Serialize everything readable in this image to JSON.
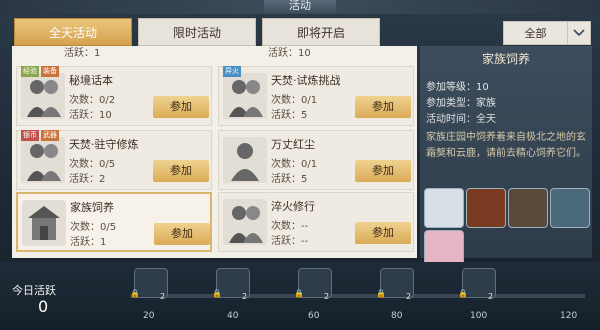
{
  "header": {
    "title": "活动"
  },
  "tabs": [
    {
      "label": "全天活动",
      "active": true
    },
    {
      "label": "限时活动",
      "active": false
    },
    {
      "label": "即将开启",
      "active": false
    }
  ],
  "filter": {
    "value": "全部"
  },
  "top_partial": {
    "left": "活跃：1",
    "right": "活跃：10"
  },
  "activities": [
    {
      "name": "秘境话本",
      "count": "次数：0/2",
      "active": "活跃：10",
      "button": "参加",
      "tags": [
        "经验",
        "装备"
      ]
    },
    {
      "name": "天焚·试炼挑战",
      "count": "次数：0/1",
      "active": "活跃：5",
      "button": "参加",
      "tags": [
        "异火"
      ]
    },
    {
      "name": "天焚·驻守修炼",
      "count": "次数：0/5",
      "active": "活跃：2",
      "button": "参加",
      "tags": [
        "银币",
        "武器"
      ]
    },
    {
      "name": "万丈红尘",
      "count": "次数：0/1",
      "active": "活跃：5",
      "button": "参加",
      "tags": []
    },
    {
      "name": "家族饲养",
      "count": "次数：0/5",
      "active": "活跃：1",
      "button": "参加",
      "tags": []
    },
    {
      "name": "淬火修行",
      "count": "次数：--",
      "active": "活跃：--",
      "button": "参加",
      "tags": []
    }
  ],
  "detail": {
    "title": "家族饲养",
    "level": "参加等级：10",
    "type": "参加类型：家族",
    "time": "活动时间：全天",
    "description": "家族庄园中饲养着来自极北之地的玄霜獒和云鹿，请前去精心饲养它们。"
  },
  "today": {
    "label": "今日活跃",
    "value": "0"
  },
  "milestones": [
    {
      "mark": "20",
      "count": "2"
    },
    {
      "mark": "40",
      "count": "2"
    },
    {
      "mark": "60",
      "count": "2"
    },
    {
      "mark": "80",
      "count": "2"
    },
    {
      "mark": "100",
      "count": "2"
    },
    {
      "mark": "120",
      "count": ""
    }
  ],
  "colors": {
    "accent": "#d9ab57",
    "panel": "#3d4d5d"
  }
}
